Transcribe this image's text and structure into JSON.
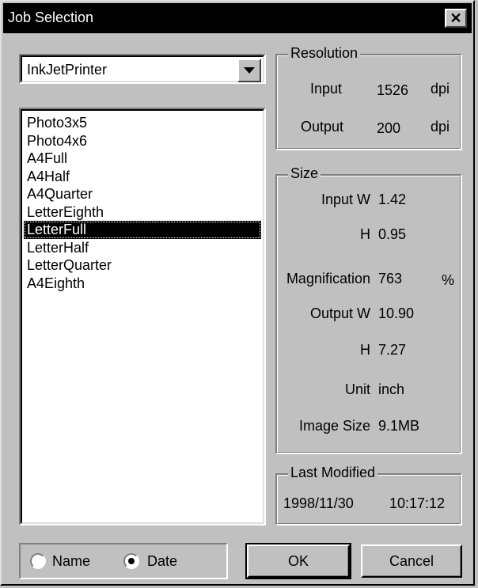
{
  "window": {
    "title": "Job Selection",
    "close_glyph": "✕"
  },
  "printer_combo": {
    "value": "InkJetPrinter"
  },
  "job_list": {
    "items": [
      "Photo3x5",
      "Photo4x6",
      "A4Full",
      "A4Half",
      "A4Quarter",
      "LetterEighth",
      "LetterFull",
      "LetterHalf",
      "LetterQuarter",
      "A4Eighth"
    ],
    "selected": "LetterFull"
  },
  "resolution": {
    "legend": "Resolution",
    "input_label": "Input",
    "input_value": "1526",
    "input_unit": "dpi",
    "output_label": "Output",
    "output_value": "200",
    "output_unit": "dpi"
  },
  "size": {
    "legend": "Size",
    "input_w_label": "Input W",
    "input_w_value": "1.42",
    "input_h_label": "H",
    "input_h_value": "0.95",
    "magnification_label": "Magnification",
    "magnification_value": "763",
    "magnification_unit": "%",
    "output_w_label": "Output W",
    "output_w_value": "10.90",
    "output_h_label": "H",
    "output_h_value": "7.27",
    "unit_label": "Unit",
    "unit_value": "inch",
    "image_size_label": "Image Size",
    "image_size_value": "9.1MB"
  },
  "last_modified": {
    "legend": "Last Modified",
    "date": "1998/11/30",
    "time": "10:17:12"
  },
  "sort": {
    "name_label": "Name",
    "date_label": "Date",
    "selected": "Date"
  },
  "buttons": {
    "ok": "OK",
    "cancel": "Cancel"
  }
}
